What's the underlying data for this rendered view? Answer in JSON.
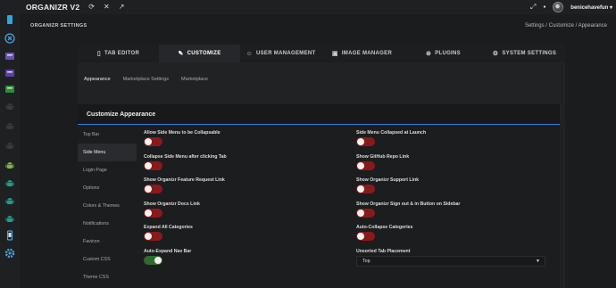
{
  "app": {
    "title": "ORGANIZR V2",
    "user": "benicehavefun"
  },
  "colors": {
    "accent": "#3a7bd5",
    "toggle_off": "#8a1a1a",
    "toggle_on": "#2f6b2f"
  },
  "header": {
    "page_title": "ORGANIZR SETTINGS",
    "breadcrumb": "Settings / Customize / Appearance"
  },
  "sidebar": {
    "items": [
      {
        "icon": "tv-icon",
        "color": "#29a9e1"
      },
      {
        "icon": "close-circle-icon",
        "color": "#4aa3df"
      },
      {
        "icon": "app-tile-icon",
        "color": "#6b4fbb"
      },
      {
        "icon": "app-tile-icon",
        "color": "#5a3fa8"
      },
      {
        "icon": "app-tile-icon",
        "color": "#2e8b3a"
      },
      {
        "icon": "android-icon",
        "color": "#3a3a3a"
      },
      {
        "icon": "android-icon",
        "color": "#3a3a3a"
      },
      {
        "icon": "android-icon",
        "color": "#3a3a3a"
      },
      {
        "icon": "android-icon",
        "color": "#7cb342"
      },
      {
        "icon": "android-icon",
        "color": "#1f9d8a"
      },
      {
        "icon": "android-icon",
        "color": "#1f9d8a"
      },
      {
        "icon": "android-icon",
        "color": "#1f9d8a"
      },
      {
        "icon": "phone-icon",
        "color": "#4aa3df"
      },
      {
        "icon": "gear-icon",
        "color": "#4aa3df"
      }
    ]
  },
  "main_tabs": [
    {
      "label": "TAB EDITOR",
      "icon": "tab-editor-icon"
    },
    {
      "label": "CUSTOMIZE",
      "icon": "paint-icon"
    },
    {
      "label": "USER MANAGEMENT",
      "icon": "user-icon"
    },
    {
      "label": "IMAGE MANAGER",
      "icon": "image-icon"
    },
    {
      "label": "PLUGINS",
      "icon": "plug-icon"
    },
    {
      "label": "SYSTEM SETTINGS",
      "icon": "gear-icon"
    }
  ],
  "sub_tabs": [
    "Appearance",
    "Marketplace Settings",
    "Marketplace"
  ],
  "panel": {
    "title": "Customize Appearance",
    "vtabs": [
      "Top Bar",
      "Side Menu",
      "Login Page",
      "Options",
      "Colors & Themes",
      "Notifications",
      "Favicon",
      "Custom CSS",
      "Theme CSS"
    ],
    "settings_left": [
      {
        "label": "Allow Side Menu to be Collapsable",
        "enabled": false
      },
      {
        "label": "Collapse Side Menu after clicking Tab",
        "enabled": false
      },
      {
        "label": "Show Organizr Feature Request Link",
        "enabled": false
      },
      {
        "label": "Show Organizr Docs Link",
        "enabled": false
      },
      {
        "label": "Expand All Categories",
        "enabled": false
      },
      {
        "label": "Auto-Expand Nav Bar",
        "enabled": true
      }
    ],
    "settings_right": [
      {
        "label": "Side Menu Collapsed at Launch",
        "enabled": false
      },
      {
        "label": "Show GitHub Repo Link",
        "enabled": false
      },
      {
        "label": "Show Organizr Support Link",
        "enabled": false
      },
      {
        "label": "Show Organizr Sign out & in Button on Sidebar",
        "enabled": false
      },
      {
        "label": "Auto-Collapse Categories",
        "enabled": false
      }
    ],
    "unsorted_placement": {
      "label": "Unsorted Tab Placement",
      "value": "Top"
    }
  }
}
